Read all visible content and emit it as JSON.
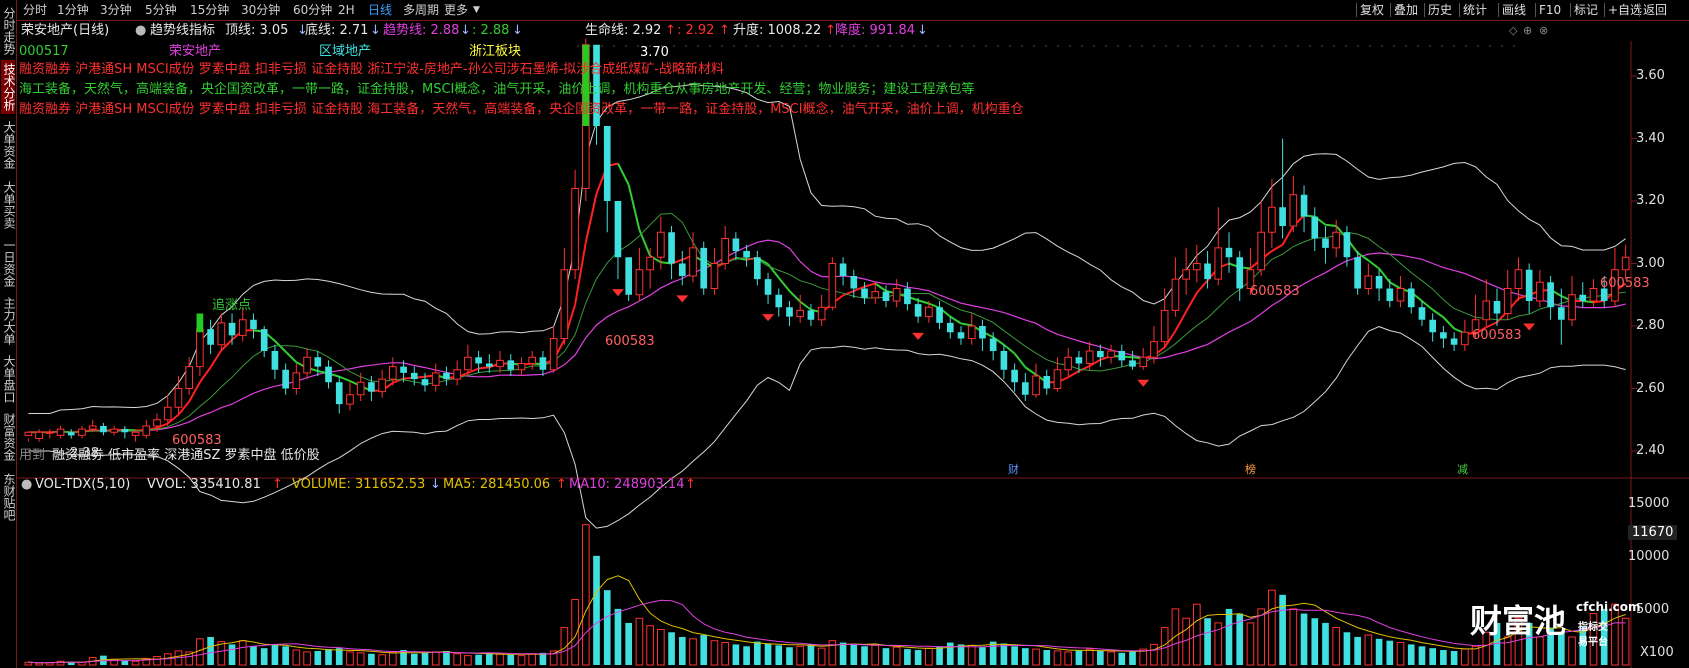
{
  "sidebar": {
    "items": [
      {
        "label": "分时走势",
        "active": false
      },
      {
        "label": "技术分析",
        "active": true
      },
      {
        "label": "大单资金",
        "active": false
      },
      {
        "label": "大单买卖",
        "active": false
      },
      {
        "label": "一日资金",
        "active": false
      },
      {
        "label": "主力大单",
        "active": false
      },
      {
        "label": "大单盘口",
        "active": false
      },
      {
        "label": "财富资金",
        "active": false
      },
      {
        "label": "东财贴吧",
        "active": false
      }
    ]
  },
  "toolbar": {
    "periods": [
      "分时",
      "1分钟",
      "3分钟",
      "5分钟",
      "15分钟",
      "30分钟",
      "60分钟",
      "2H",
      "日线",
      "多周期",
      "更多"
    ],
    "active_period": "日线",
    "right_buttons": [
      "复权",
      "叠加",
      "历史",
      "统计",
      "画线",
      "F10",
      "标记",
      "+自选",
      "返回"
    ]
  },
  "header": {
    "title": "荣安地产(日线)",
    "indicator_name": "趋势线指标",
    "top_line": "顶线: 3.05",
    "bottom_line": "底线: 2.71",
    "trend_line": "趋势线: 2.88",
    "trend_line_b": ": 2.88",
    "life_line": "生命线: 2.92",
    "life_line_b": ": 2.92",
    "rise_level": "升度: 1008.22",
    "fall_level": "降度: 991.84"
  },
  "tags": {
    "code": "000517",
    "name": "荣安地产",
    "region": "区域地产",
    "sector": "浙江板块",
    "line1": "融资融券 沪港通SH MSCI成份 罗素中盘 扣非亏损 证金持股 浙江宁波-房地产-孙公司涉石墨烯-拟涉合成纸煤矿-战略新材料",
    "line2": "海工装备，天然气，高端装备，央企国资改革，一带一路，证金持股，MSCI概念，油气开采，油价上调，机构重仓从事房地产开发、经营；物业服务；建设工程承包等",
    "line3": "融资融券 沪港通SH MSCI成份 罗素中盘 扣非亏损 证金持股 海工装备，天然气，高端装备，央企国资改革，一带一路，证金持股，MSCI概念，油气开采，油价上调，机构重仓",
    "bottom_tags": "融资融券 低市盈率 深港通SZ 罗素中盘 低价股",
    "bottom_prefix": "用到"
  },
  "annotations": {
    "chase": "追涨点",
    "code_mark": "600583",
    "peak": "3.70",
    "low": "2.38",
    "event_cai": "财",
    "event_bang": "榜",
    "event_jian": "减"
  },
  "volume_header": {
    "name": "VOL-TDX(5,10)",
    "vvol": "VVOL: 335410.81",
    "volume": "VOLUME: 311652.53",
    "ma5": "MA5: 281450.06",
    "ma10": "MA10: 248903.14"
  },
  "price_axis": [
    "3.60",
    "3.40",
    "3.20",
    "3.00",
    "2.80",
    "2.60",
    "2.40"
  ],
  "volume_axis": [
    "15000",
    "10000",
    "5000"
  ],
  "volume_cursor_label": "11670",
  "volume_unit": "X100",
  "watermark": {
    "main": "财富池",
    "domain": "cfchi.com",
    "sub": "指标交易平台"
  },
  "colors": {
    "up": "#ff3030",
    "down": "#40e0e0",
    "ma_white": "#d8d8d8",
    "ma_magenta": "#e040e0",
    "ma_green": "#33cc33",
    "ma_red": "#ff2020",
    "vol_ma5": "#e0c000",
    "vol_ma10": "#e040e0"
  },
  "chart_data": {
    "type": "candlestick",
    "ylim": [
      2.35,
      3.72
    ],
    "candles": [
      [
        2.45,
        2.46,
        2.44,
        2.43
      ],
      [
        2.44,
        2.46,
        2.47,
        2.43
      ],
      [
        2.46,
        2.46,
        2.47,
        2.44
      ],
      [
        2.45,
        2.47,
        2.48,
        2.44
      ],
      [
        2.46,
        2.45,
        2.47,
        2.44
      ],
      [
        2.45,
        2.47,
        2.48,
        2.44
      ],
      [
        2.47,
        2.48,
        2.5,
        2.46
      ],
      [
        2.48,
        2.46,
        2.49,
        2.45
      ],
      [
        2.46,
        2.47,
        2.48,
        2.45
      ],
      [
        2.47,
        2.46,
        2.48,
        2.44
      ],
      [
        2.45,
        2.46,
        2.47,
        2.43
      ],
      [
        2.45,
        2.48,
        2.5,
        2.44
      ],
      [
        2.48,
        2.5,
        2.52,
        2.46
      ],
      [
        2.5,
        2.54,
        2.58,
        2.48
      ],
      [
        2.54,
        2.6,
        2.64,
        2.52
      ],
      [
        2.6,
        2.67,
        2.7,
        2.58
      ],
      [
        2.67,
        2.79,
        2.83,
        2.64
      ],
      [
        2.79,
        2.74,
        2.82,
        2.71
      ],
      [
        2.74,
        2.81,
        2.84,
        2.72
      ],
      [
        2.81,
        2.77,
        2.84,
        2.74
      ],
      [
        2.77,
        2.82,
        2.86,
        2.75
      ],
      [
        2.82,
        2.79,
        2.84,
        2.76
      ],
      [
        2.79,
        2.72,
        2.8,
        2.7
      ],
      [
        2.72,
        2.66,
        2.74,
        2.63
      ],
      [
        2.66,
        2.6,
        2.68,
        2.58
      ],
      [
        2.6,
        2.65,
        2.68,
        2.58
      ],
      [
        2.65,
        2.7,
        2.73,
        2.63
      ],
      [
        2.7,
        2.67,
        2.72,
        2.64
      ],
      [
        2.67,
        2.62,
        2.69,
        2.6
      ],
      [
        2.62,
        2.55,
        2.64,
        2.52
      ],
      [
        2.55,
        2.58,
        2.62,
        2.53
      ],
      [
        2.58,
        2.62,
        2.65,
        2.56
      ],
      [
        2.62,
        2.59,
        2.64,
        2.56
      ],
      [
        2.59,
        2.63,
        2.66,
        2.57
      ],
      [
        2.63,
        2.67,
        2.7,
        2.61
      ],
      [
        2.67,
        2.65,
        2.69,
        2.62
      ],
      [
        2.65,
        2.63,
        2.67,
        2.61
      ],
      [
        2.63,
        2.61,
        2.65,
        2.59
      ],
      [
        2.61,
        2.65,
        2.68,
        2.59
      ],
      [
        2.65,
        2.63,
        2.67,
        2.61
      ],
      [
        2.63,
        2.66,
        2.69,
        2.61
      ],
      [
        2.66,
        2.7,
        2.74,
        2.64
      ],
      [
        2.7,
        2.68,
        2.72,
        2.65
      ],
      [
        2.68,
        2.67,
        2.71,
        2.65
      ],
      [
        2.67,
        2.69,
        2.72,
        2.65
      ],
      [
        2.69,
        2.66,
        2.71,
        2.64
      ],
      [
        2.66,
        2.68,
        2.7,
        2.64
      ],
      [
        2.68,
        2.7,
        2.72,
        2.66
      ],
      [
        2.7,
        2.66,
        2.72,
        2.64
      ],
      [
        2.66,
        2.76,
        2.8,
        2.65
      ],
      [
        2.76,
        2.98,
        3.05,
        2.74
      ],
      [
        2.98,
        3.24,
        3.3,
        2.95
      ],
      [
        3.24,
        3.7,
        3.72,
        3.2
      ],
      [
        3.7,
        3.44,
        3.62,
        3.38
      ],
      [
        3.44,
        3.2,
        3.42,
        3.1
      ],
      [
        3.2,
        3.02,
        3.18,
        2.95
      ],
      [
        3.02,
        2.9,
        3.0,
        2.88
      ],
      [
        2.9,
        2.98,
        3.05,
        2.88
      ],
      [
        2.98,
        3.02,
        3.05,
        2.92
      ],
      [
        3.02,
        3.1,
        3.15,
        2.98
      ],
      [
        3.1,
        3.0,
        3.12,
        2.95
      ],
      [
        3.0,
        2.96,
        3.04,
        2.93
      ],
      [
        2.96,
        3.05,
        3.1,
        2.94
      ],
      [
        3.05,
        2.92,
        3.07,
        2.9
      ],
      [
        2.92,
        3.0,
        3.05,
        2.9
      ],
      [
        3.0,
        3.08,
        3.12,
        2.98
      ],
      [
        3.08,
        3.04,
        3.1,
        3.01
      ],
      [
        3.04,
        3.02,
        3.06,
        2.99
      ],
      [
        3.02,
        2.95,
        3.04,
        2.93
      ],
      [
        2.95,
        2.9,
        2.97,
        2.87
      ],
      [
        2.9,
        2.86,
        2.92,
        2.83
      ],
      [
        2.86,
        2.83,
        2.88,
        2.8
      ],
      [
        2.83,
        2.85,
        2.9,
        2.81
      ],
      [
        2.85,
        2.82,
        2.87,
        2.8
      ],
      [
        2.82,
        2.86,
        2.9,
        2.8
      ],
      [
        2.86,
        3.0,
        3.02,
        2.85
      ],
      [
        3.0,
        2.96,
        3.02,
        2.93
      ],
      [
        2.96,
        2.92,
        2.98,
        2.89
      ],
      [
        2.92,
        2.89,
        2.94,
        2.87
      ],
      [
        2.89,
        2.91,
        2.94,
        2.87
      ],
      [
        2.91,
        2.88,
        2.93,
        2.86
      ],
      [
        2.88,
        2.92,
        2.95,
        2.86
      ],
      [
        2.92,
        2.87,
        2.94,
        2.85
      ],
      [
        2.87,
        2.83,
        2.89,
        2.81
      ],
      [
        2.83,
        2.86,
        2.88,
        2.81
      ],
      [
        2.86,
        2.81,
        2.88,
        2.79
      ],
      [
        2.81,
        2.78,
        2.83,
        2.76
      ],
      [
        2.78,
        2.76,
        2.8,
        2.74
      ],
      [
        2.76,
        2.8,
        2.84,
        2.74
      ],
      [
        2.8,
        2.76,
        2.82,
        2.72
      ],
      [
        2.76,
        2.72,
        2.78,
        2.69
      ],
      [
        2.72,
        2.66,
        2.74,
        2.63
      ],
      [
        2.66,
        2.62,
        2.68,
        2.59
      ],
      [
        2.62,
        2.58,
        2.65,
        2.56
      ],
      [
        2.58,
        2.64,
        2.68,
        2.57
      ],
      [
        2.64,
        2.6,
        2.66,
        2.58
      ],
      [
        2.6,
        2.66,
        2.7,
        2.59
      ],
      [
        2.66,
        2.7,
        2.73,
        2.64
      ],
      [
        2.7,
        2.68,
        2.72,
        2.65
      ],
      [
        2.68,
        2.72,
        2.75,
        2.66
      ],
      [
        2.72,
        2.7,
        2.74,
        2.67
      ],
      [
        2.7,
        2.72,
        2.74,
        2.68
      ],
      [
        2.72,
        2.69,
        2.74,
        2.67
      ],
      [
        2.69,
        2.67,
        2.72,
        2.66
      ],
      [
        2.67,
        2.7,
        2.73,
        2.66
      ],
      [
        2.7,
        2.75,
        2.8,
        2.68
      ],
      [
        2.75,
        2.85,
        2.92,
        2.73
      ],
      [
        2.85,
        2.95,
        3.02,
        2.83
      ],
      [
        2.95,
        2.98,
        3.05,
        2.9
      ],
      [
        2.98,
        3.0,
        3.06,
        2.94
      ],
      [
        3.0,
        2.95,
        3.04,
        2.92
      ],
      [
        2.95,
        3.05,
        3.18,
        2.93
      ],
      [
        3.05,
        3.02,
        3.1,
        2.97
      ],
      [
        3.02,
        2.92,
        3.04,
        2.88
      ],
      [
        2.92,
        2.98,
        3.05,
        2.9
      ],
      [
        2.98,
        3.1,
        3.2,
        2.96
      ],
      [
        3.1,
        3.18,
        3.27,
        3.05
      ],
      [
        3.18,
        3.12,
        3.4,
        3.08
      ],
      [
        3.12,
        3.22,
        3.28,
        3.1
      ],
      [
        3.22,
        3.15,
        3.25,
        3.1
      ],
      [
        3.15,
        3.08,
        3.18,
        3.04
      ],
      [
        3.08,
        3.05,
        3.12,
        3.0
      ],
      [
        3.05,
        3.1,
        3.14,
        3.02
      ],
      [
        3.1,
        3.02,
        3.12,
        2.99
      ],
      [
        3.02,
        2.92,
        3.04,
        2.9
      ],
      [
        2.92,
        2.96,
        3.0,
        2.9
      ],
      [
        2.96,
        2.92,
        2.98,
        2.88
      ],
      [
        2.92,
        2.88,
        2.95,
        2.86
      ],
      [
        2.88,
        2.92,
        2.96,
        2.86
      ],
      [
        2.92,
        2.86,
        2.94,
        2.84
      ],
      [
        2.86,
        2.82,
        2.88,
        2.8
      ],
      [
        2.82,
        2.78,
        2.84,
        2.75
      ],
      [
        2.78,
        2.76,
        2.8,
        2.73
      ],
      [
        2.76,
        2.74,
        2.78,
        2.72
      ],
      [
        2.74,
        2.78,
        2.82,
        2.72
      ],
      [
        2.78,
        2.82,
        2.9,
        2.76
      ],
      [
        2.82,
        2.88,
        2.95,
        2.8
      ],
      [
        2.88,
        2.84,
        2.92,
        2.8
      ],
      [
        2.84,
        2.92,
        2.98,
        2.82
      ],
      [
        2.92,
        2.98,
        3.02,
        2.88
      ],
      [
        2.98,
        2.88,
        3.0,
        2.84
      ],
      [
        2.88,
        2.94,
        2.98,
        2.86
      ],
      [
        2.94,
        2.86,
        2.96,
        2.82
      ],
      [
        2.86,
        2.82,
        2.92,
        2.74
      ],
      [
        2.82,
        2.9,
        2.96,
        2.8
      ],
      [
        2.9,
        2.88,
        2.94,
        2.86
      ],
      [
        2.88,
        2.92,
        2.95,
        2.86
      ],
      [
        2.92,
        2.88,
        2.96,
        2.86
      ],
      [
        2.88,
        2.98,
        3.05,
        2.86
      ],
      [
        2.98,
        3.02,
        3.06,
        2.95
      ]
    ],
    "volumes": [
      300,
      200,
      250,
      400,
      350,
      300,
      800,
      1000,
      600,
      500,
      400,
      700,
      900,
      1200,
      1500,
      1400,
      2800,
      3000,
      2500,
      2200,
      2600,
      2000,
      1800,
      2200,
      2000,
      1600,
      1400,
      1500,
      1700,
      1800,
      1400,
      1300,
      1200,
      1100,
      1400,
      1600,
      1200,
      1300,
      1400,
      1500,
      1200,
      1000,
      1100,
      1300,
      1200,
      1100,
      1000,
      1200,
      1300,
      1500,
      4000,
      7000,
      15000,
      11670,
      8000,
      6000,
      4500,
      5000,
      4200,
      3800,
      3500,
      3000,
      2800,
      3200,
      2600,
      2400,
      2200,
      2000,
      2500,
      2300,
      2100,
      1900,
      2000,
      2200,
      1800,
      2600,
      2400,
      2200,
      2000,
      2100,
      1800,
      1900,
      1700,
      1600,
      1800,
      2000,
      2400,
      2200,
      2100,
      1900,
      2500,
      2300,
      2000,
      1800,
      1700,
      1600,
      1500,
      1400,
      1600,
      1700,
      1500,
      1400,
      1300,
      1500,
      1700,
      2200,
      4000,
      6000,
      5000,
      6500,
      5000,
      4500,
      6000,
      5500,
      4500,
      6000,
      8000,
      7500,
      6000,
      5500,
      5000,
      4500,
      4000,
      3500,
      3000,
      3200,
      2800,
      2600,
      2400,
      2200,
      2000,
      1800,
      1600,
      1500,
      1700,
      2000,
      3500,
      4500,
      3000,
      5000,
      4500,
      3000,
      4000,
      3500,
      3000,
      4000,
      5500,
      6000,
      6500,
      5000
    ],
    "volume_ylim": [
      0,
      17000
    ]
  }
}
